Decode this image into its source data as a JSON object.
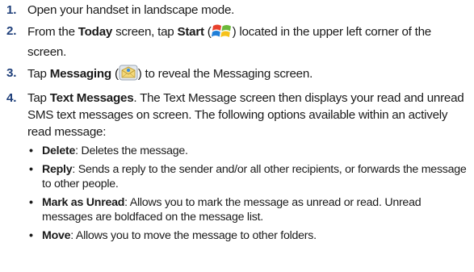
{
  "steps": [
    {
      "num": "1.",
      "text": "Open your handset in landscape mode."
    },
    {
      "num": "2.",
      "pre": "From the ",
      "kw1": "Today",
      "mid": " screen, tap ",
      "kw2": "Start",
      "open": " (",
      "close": ") located in the upper left corner of the screen.",
      "icon": "windows-start-icon"
    },
    {
      "num": "3.",
      "pre": "Tap ",
      "kw1": "Messaging",
      "open": " (",
      "close": ") to reveal the Messaging screen.",
      "icon": "messaging-envelope-icon"
    },
    {
      "num": "4.",
      "pre": "Tap ",
      "kw1": "Text Messages",
      "rest": ". The Text Message screen then displays your read and unread SMS text messages on screen. The following options available within an actively read message:"
    }
  ],
  "bullets": [
    {
      "term": "Delete",
      "desc": ": Deletes the message."
    },
    {
      "term": "Reply",
      "desc": ": Sends a reply to the sender and/or all other recipients, or forwards the message to other people."
    },
    {
      "term": "Mark as Unread",
      "desc": ": Allows you to mark the message as unread or read. Unread messages are boldfaced on the message list."
    },
    {
      "term": "Move",
      "desc": ": Allows you to move the message to other folders."
    }
  ],
  "bullet_char": "•",
  "colors": {
    "step_number": "#1f3f7a",
    "text": "#1a1a1a"
  }
}
